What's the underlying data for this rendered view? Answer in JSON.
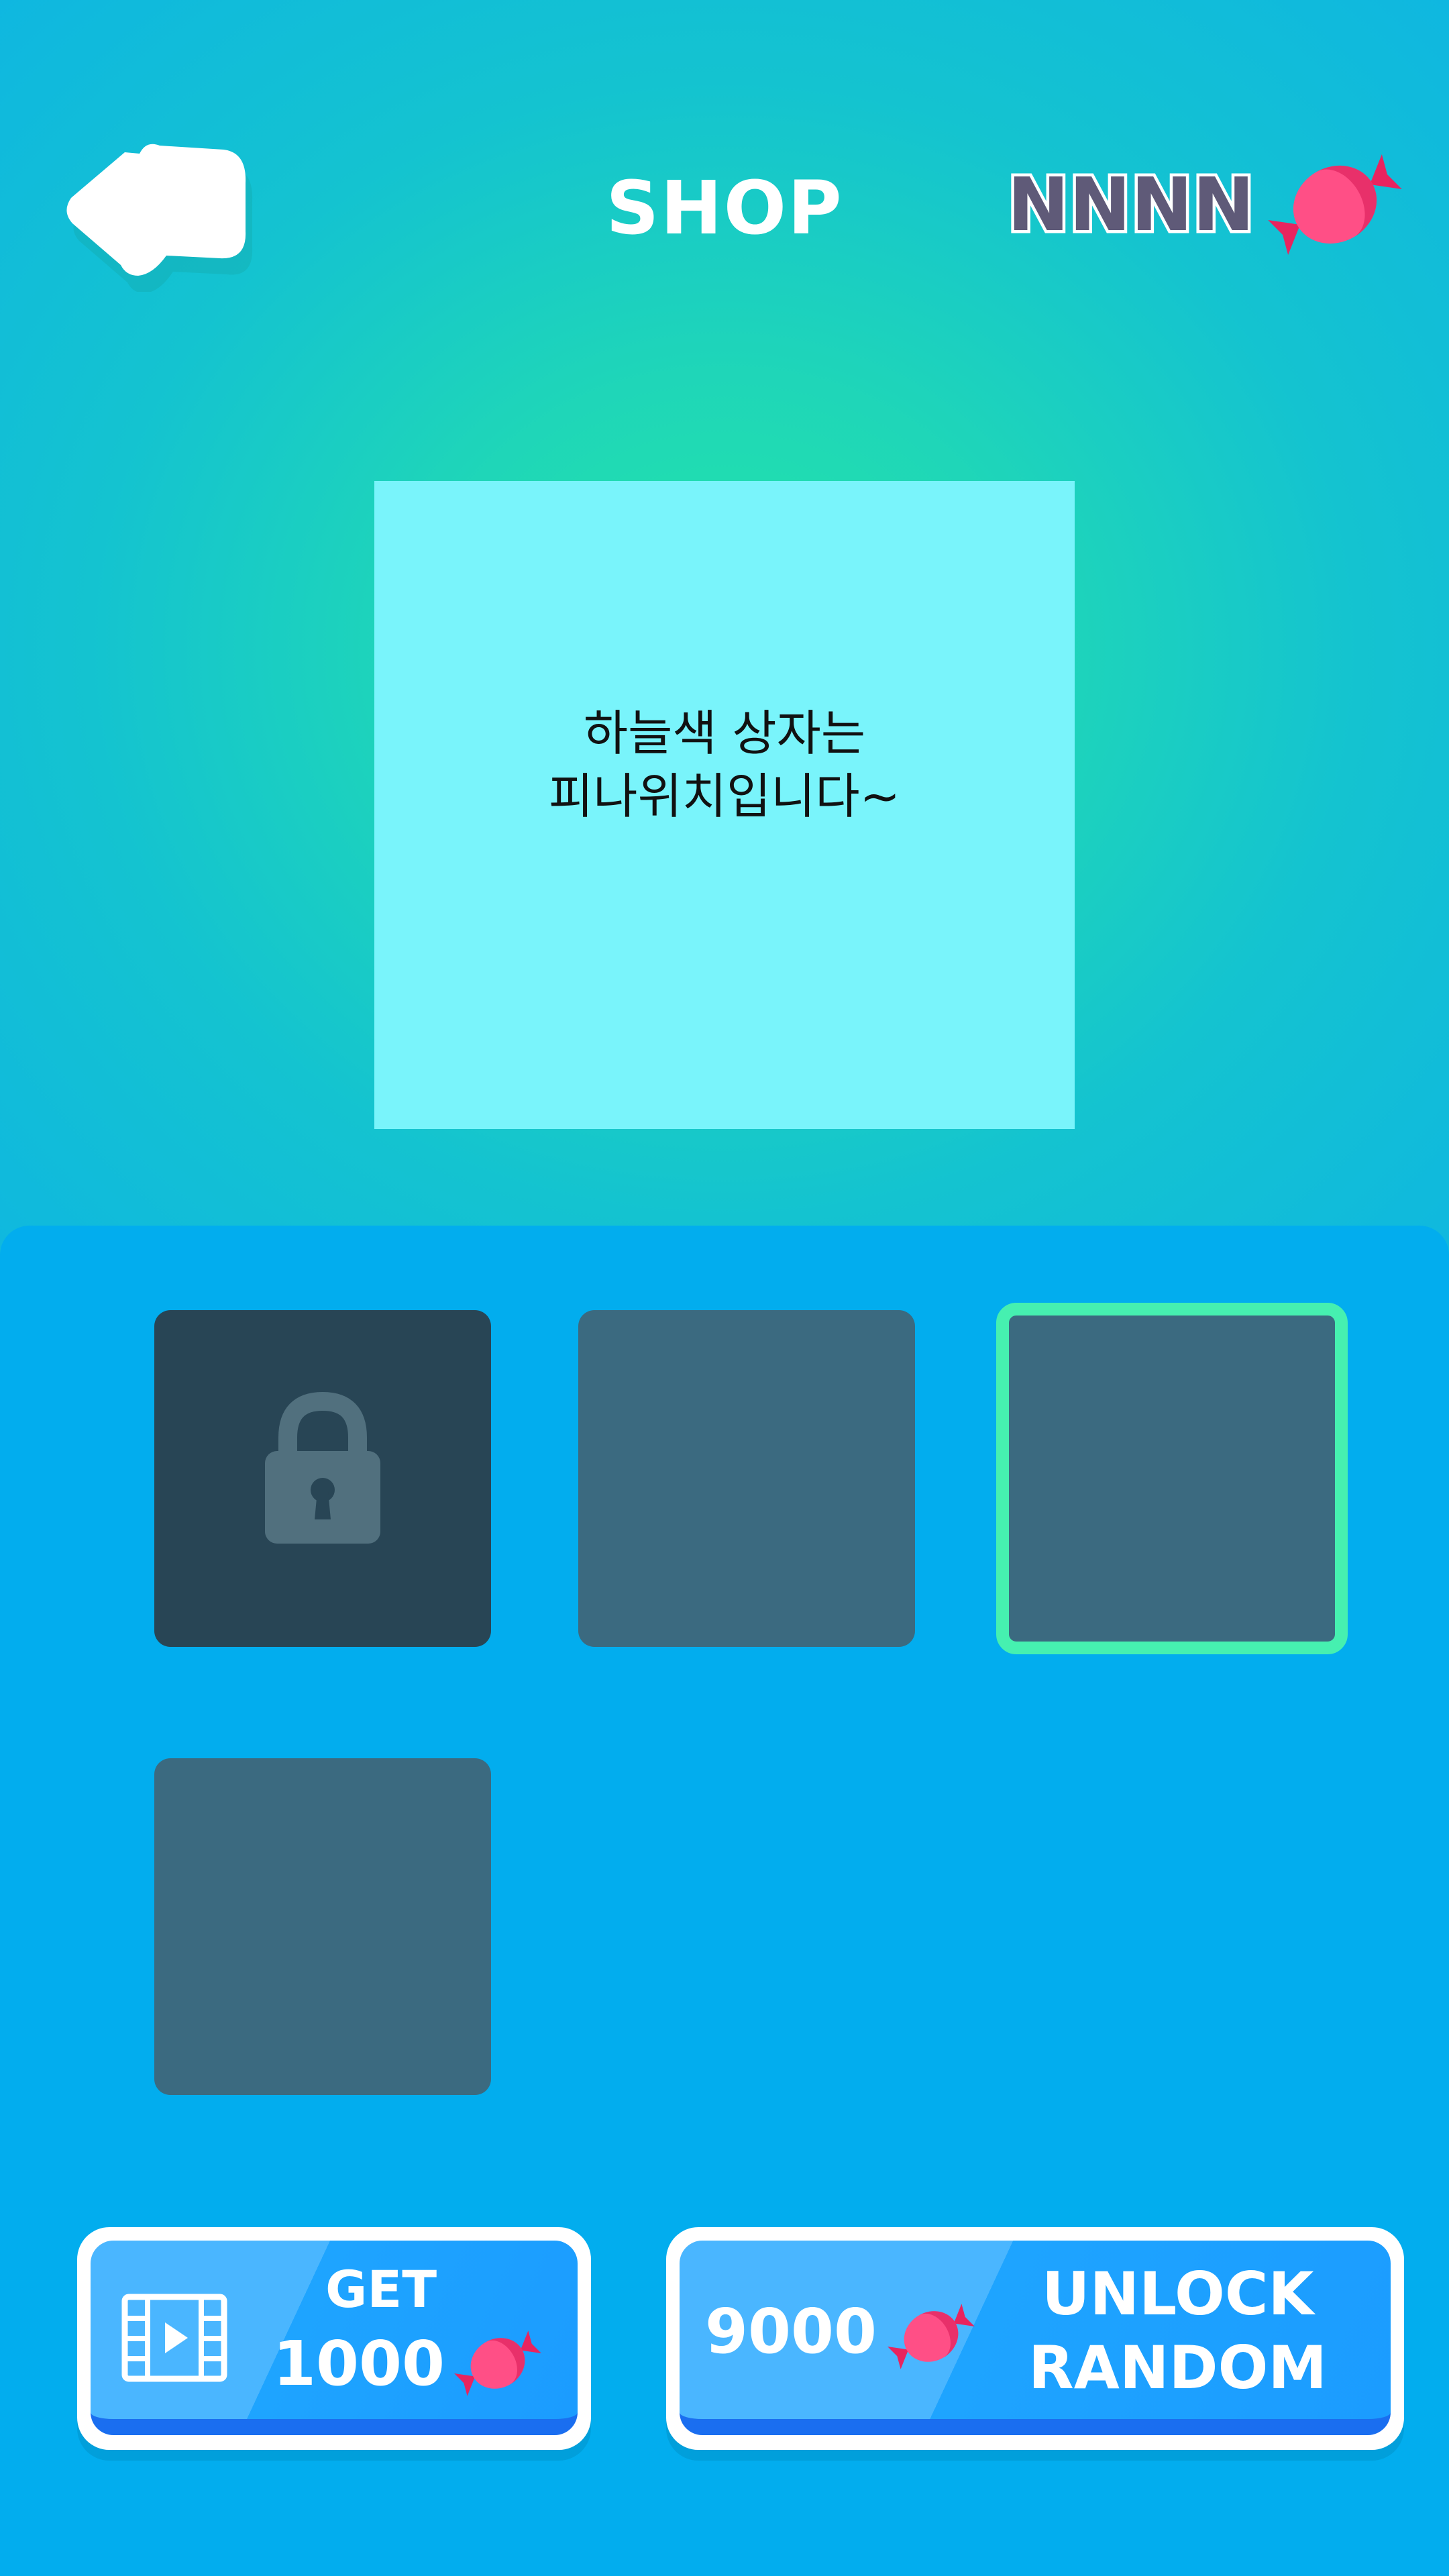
{
  "header": {
    "title": "SHOP",
    "currency_amount": "NNNN",
    "back_icon": "back-arrow-icon",
    "currency_icon": "candy-icon"
  },
  "preview": {
    "text": "하늘색 상자는\n피나위치입니다~"
  },
  "grid": {
    "items": [
      {
        "state": "locked",
        "icon": "lock-icon"
      },
      {
        "state": "unlocked"
      },
      {
        "state": "selected"
      },
      {
        "state": "unlocked"
      }
    ]
  },
  "actions": {
    "get_button": {
      "line1": "GET",
      "amount": "1000",
      "icon": "video-icon"
    },
    "unlock_button": {
      "price": "9000",
      "line1": "UNLOCK",
      "line2": "RANDOM"
    }
  },
  "colors": {
    "top_gradient_center": "#22e6a8",
    "top_gradient_edge": "#0fb7e0",
    "panel": "#02adee",
    "preview_box": "#79f4fb",
    "slot": "#3b6a80",
    "slot_locked": "#284555",
    "selected_border": "#46f0b0",
    "button_blue": "#1ea4ff",
    "currency_text": "#5f5a78",
    "candy": "#ff3f7f"
  }
}
